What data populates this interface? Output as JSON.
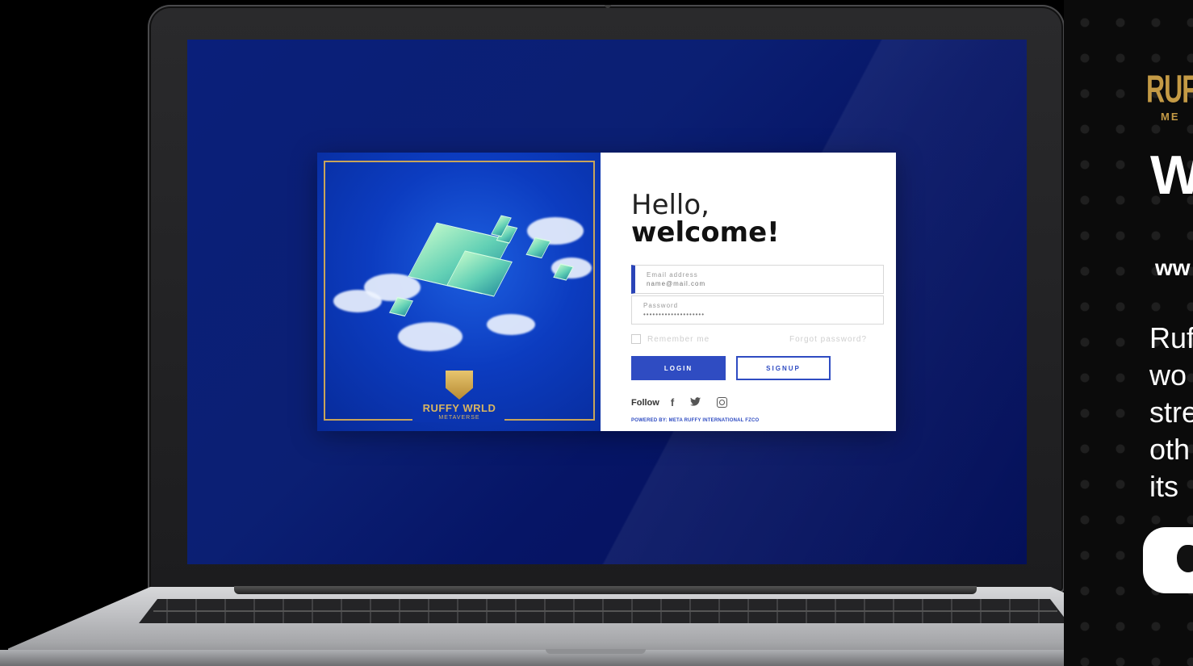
{
  "login": {
    "greeting": "Hello,",
    "welcome": "welcome!",
    "email_label": "Email address",
    "email_placeholder": "name@mail.com",
    "password_label": "Password",
    "password_value": "••••••••••••••••••••",
    "remember_label": "Remember me",
    "forgot_label": "Forgot password?",
    "login_button": "LOGIN",
    "signup_button": "SIGNUP",
    "follow_label": "Follow",
    "social": [
      "facebook-icon",
      "twitter-icon",
      "instagram-icon"
    ],
    "powered_by": "POWERED BY: META RUFFY INTERNATIONAL FZCO"
  },
  "art": {
    "logo_text": "RUFFY WRLD",
    "logo_sub": "METAVERSE"
  },
  "side_panel": {
    "logo": "RUF",
    "logo_sub": "ME",
    "heading": "W",
    "url": "ww",
    "description_lines": [
      "Ruf",
      "wo",
      "stre",
      "oth",
      "its"
    ],
    "store_button_icon": "apple-icon"
  },
  "colors": {
    "screen_bg": "#0b1f73",
    "accent": "#2f4cc2",
    "gold": "#c49a45"
  }
}
